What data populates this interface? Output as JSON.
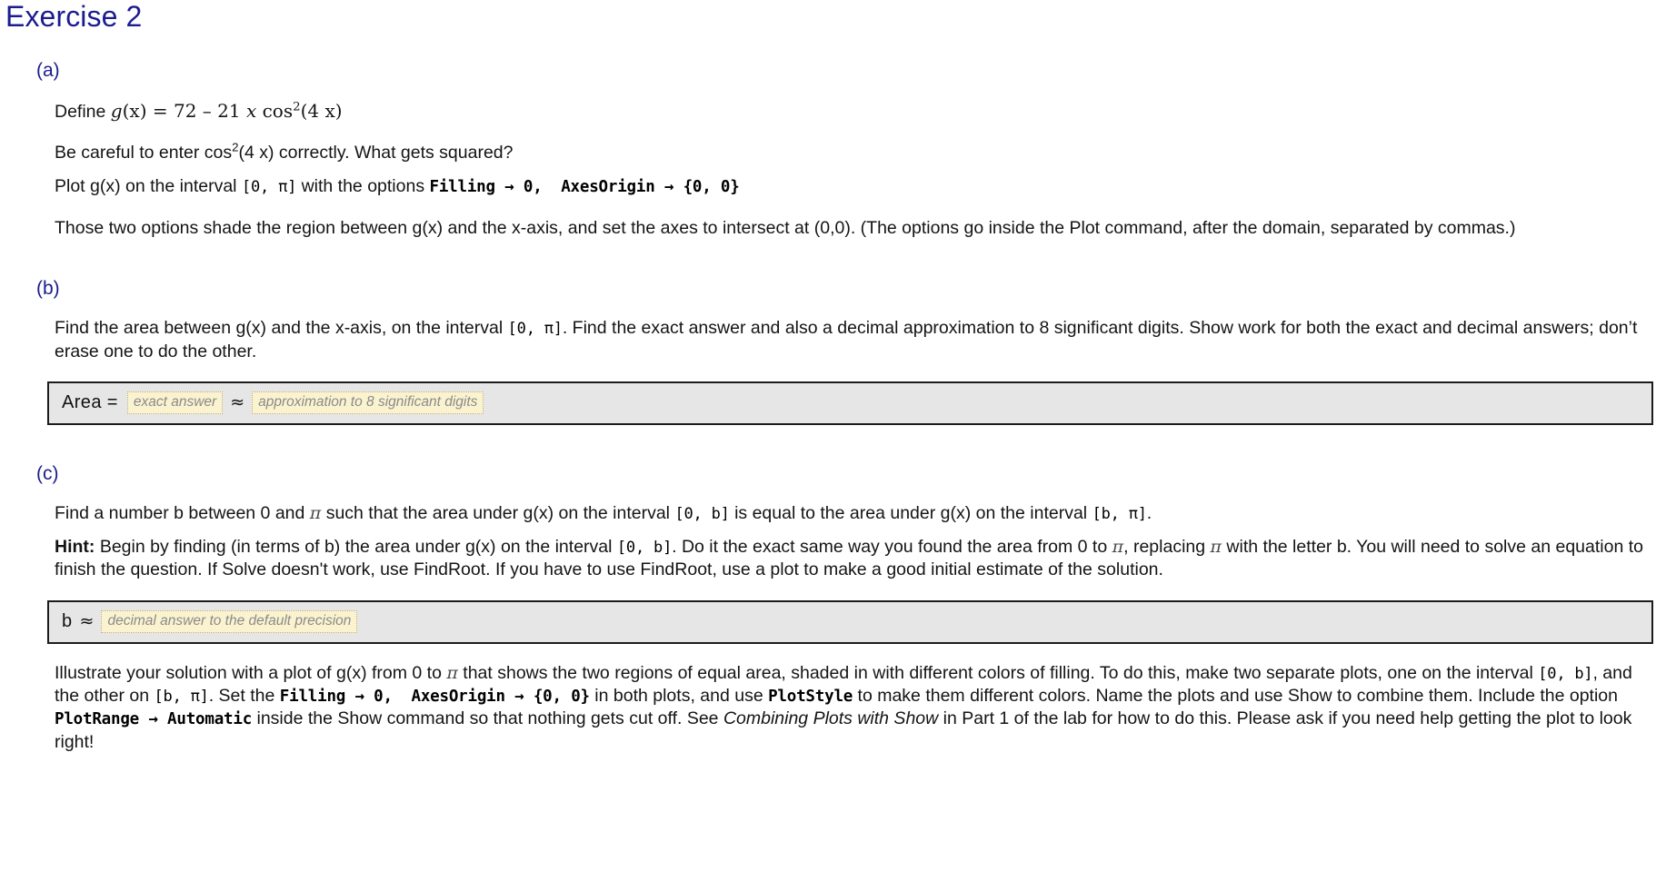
{
  "document": {
    "title": "Exercise 2",
    "accent_color": "#1b1c8f",
    "text_color": "#141414",
    "answer_box_bg": "#e6e6e6",
    "placeholder_bg": "#fbf3cf"
  },
  "parts": {
    "a": {
      "letter": "(a)",
      "define_prefix": "Define ",
      "define_g": "g",
      "define_x1": "(x)",
      "define_eq": " = ",
      "define_72": "72",
      "define_minus": " – ",
      "define_21": "21",
      "define_xvar": " x ",
      "define_cos": "cos",
      "define_sq": "2",
      "define_arg": "(4 x)",
      "careful_1": "Be careful to enter cos",
      "careful_sup": "2",
      "careful_2": "(4 x) correctly. What gets squared?",
      "plot_1": "Plot g(x) on the interval ",
      "plot_interval": "[0, π]",
      "plot_2": " with the options ",
      "plot_code_filling": "Filling → 0,",
      "plot_code_axes": "AxesOrigin → {0, 0}",
      "those_options": "Those two options shade the region between g(x) and the x-axis, and set the axes to intersect at (0,0). (The options go inside the Plot command, after the domain, separated by commas.)"
    },
    "b": {
      "letter": "(b)",
      "text_1": "Find the area between g(x) and the x-axis, on the interval ",
      "interval": "[0, π]",
      "text_2": ". Find the exact answer and also a decimal approximation to 8 significant digits. Show work for both the exact and decimal answers; don’t erase one to do the other.",
      "answer_label": "Area =",
      "approx_sign": "≈",
      "placeholder_exact": "exact answer",
      "placeholder_approx": "approximation to 8 significant digits"
    },
    "c": {
      "letter": "(c)",
      "text_1": "Find a number b between 0 and ",
      "pi": "π",
      "text_2": " such that the area under g(x) on the interval ",
      "interval_0b": "[0, b]",
      "text_3": " is equal to the area under g(x) on the interval ",
      "interval_bpi": "[b, π]",
      "text_4": ".",
      "hint_label": "Hint:",
      "hint_1": " Begin by finding (in terms of b) the area under g(x) on the interval ",
      "hint_interval": "[0, b]",
      "hint_2": ". Do it the exact same way you found the area from 0 to ",
      "hint_pi": "π",
      "hint_3": ", replacing ",
      "hint_pi2": "π",
      "hint_4": " with the letter b. You will need to solve an equation to finish the question. If Solve doesn't work, use FindRoot. If you have to use FindRoot, use a plot to make a good initial estimate of the solution.",
      "answer_label": "b",
      "approx_sign": "≈",
      "placeholder_b": "decimal answer to the default precision",
      "illus_1": "Illustrate your solution with a plot of g(x) from 0 to ",
      "illus_pi": "π",
      "illus_2": " that shows the two regions of equal area, shaded in with different colors of filling. To do this, make two separate plots, one on the interval ",
      "illus_interval_0b": "[0, b]",
      "illus_3": ", and the other on ",
      "illus_interval_bpi": "[b, π]",
      "illus_4": ". Set the ",
      "illus_code_filling": "Filling → 0,",
      "illus_code_axes": "AxesOrigin → {0, 0}",
      "illus_5": " in both plots, and use ",
      "illus_code_plotstyle": "PlotStyle",
      "illus_6": " to make them different colors. Name the plots and use Show to combine them. Include the option ",
      "illus_code_plotrange": "PlotRange → Automatic",
      "illus_7": " inside the Show command so that nothing gets cut off. See ",
      "illus_italic": "Combining Plots with Show",
      "illus_8": " in Part 1 of the lab for how to do this. Please ask if you need help getting the plot to look right!"
    }
  }
}
